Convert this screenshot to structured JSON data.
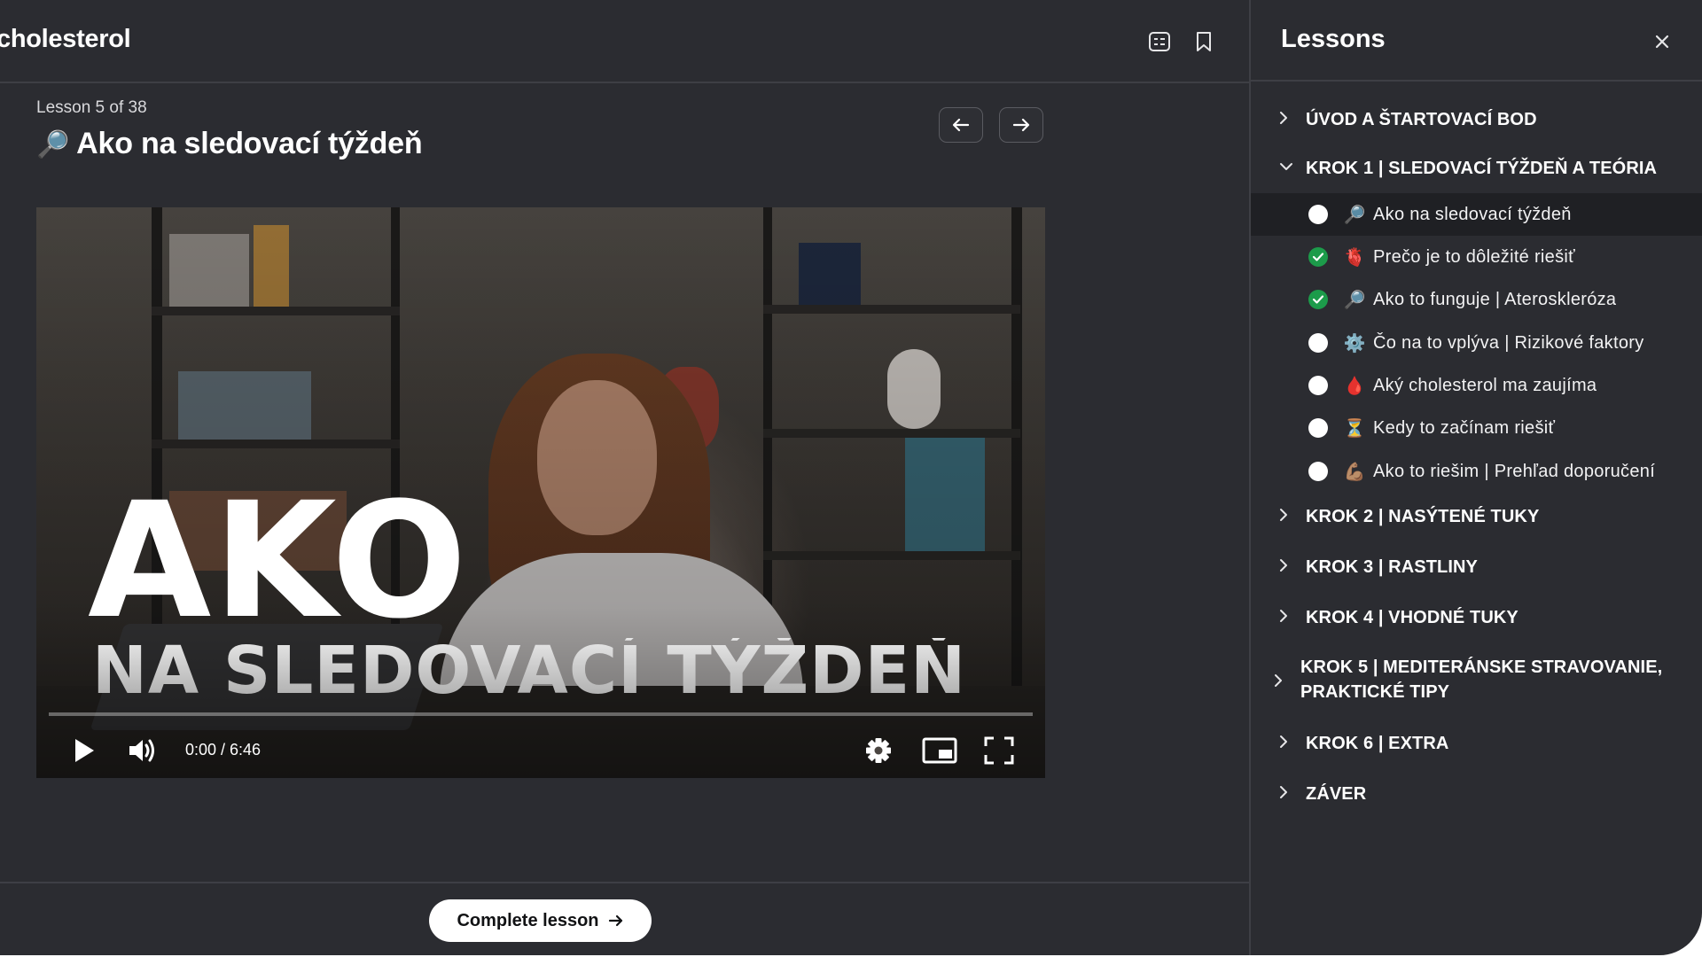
{
  "header": {
    "course_title": "cholesterol",
    "icons": [
      "notes-icon",
      "bookmark-icon"
    ]
  },
  "lesson": {
    "counter": "Lesson 5 of 38",
    "emoji": "🔎",
    "title": "Ako na sledovací týždeň",
    "prev_icon": "arrow-left-icon",
    "next_icon": "arrow-right-icon"
  },
  "video": {
    "overlay_title_line1": "AKO",
    "overlay_title_line2": "NA SLEDOVACÍ TÝŽDEŇ",
    "time_display": "0:00 / 6:46",
    "progress_fraction": 0.0,
    "controls": [
      "play-icon",
      "volume-icon",
      "settings-icon",
      "miniplayer-icon",
      "fullscreen-icon"
    ]
  },
  "footer": {
    "complete_label": "Complete lesson"
  },
  "sidebar": {
    "title": "Lessons",
    "sections": [
      {
        "label": "ÚVOD A ŠTARTOVACÍ BOD",
        "expanded": false
      },
      {
        "label": "KROK 1 | SLEDOVACÍ TÝŽDEŇ A TEÓRIA",
        "expanded": true
      },
      {
        "label": "KROK 2 | NASÝTENÉ TUKY",
        "expanded": false
      },
      {
        "label": "KROK 3 | RASTLINY",
        "expanded": false
      },
      {
        "label": "KROK 4 | VHODNÉ TUKY",
        "expanded": false
      },
      {
        "label": "KROK 5 | MEDITERÁNSKE STRAVOVANIE, PRAKTICKÉ TIPY",
        "expanded": false
      },
      {
        "label": "KROK 6 | EXTRA",
        "expanded": false
      },
      {
        "label": "ZÁVER",
        "expanded": false
      }
    ],
    "lessons": [
      {
        "emoji": "🔎",
        "label": "Ako na sledovací týždeň",
        "completed": false,
        "active": true
      },
      {
        "emoji": "🫀",
        "label": "Prečo je to dôležité riešiť",
        "completed": true,
        "active": false
      },
      {
        "emoji": "🔎",
        "label": "Ako to funguje | Ateroskleróza",
        "completed": true,
        "active": false
      },
      {
        "emoji": "⚙️",
        "label": "Čo na to vplýva | Rizikové faktory",
        "completed": false,
        "active": false
      },
      {
        "emoji": "🩸",
        "label": "Aký cholesterol ma zaujíma",
        "completed": false,
        "active": false
      },
      {
        "emoji": "⏳",
        "label": "Kedy to začínam riešiť",
        "completed": false,
        "active": false
      },
      {
        "emoji": "💪🏽",
        "label": "Ako to riešim | Prehľad doporučení",
        "completed": false,
        "active": false
      }
    ]
  },
  "colors": {
    "background": "#2b2c31",
    "active_row": "#1f2024",
    "done_green": "#1c9b4a",
    "divider": "#3e3f45"
  }
}
